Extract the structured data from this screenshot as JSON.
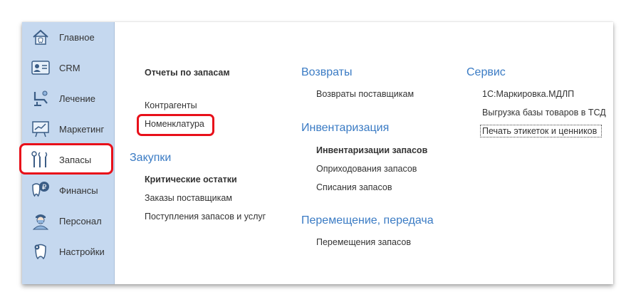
{
  "sidebar": {
    "items": [
      {
        "label": "Главное",
        "icon": "tooth-home-icon"
      },
      {
        "label": "CRM",
        "icon": "contact-card-icon"
      },
      {
        "label": "Лечение",
        "icon": "dental-chair-icon"
      },
      {
        "label": "Маркетинг",
        "icon": "presentation-board-icon"
      },
      {
        "label": "Запасы",
        "icon": "dental-tools-icon"
      },
      {
        "label": "Финансы",
        "icon": "tooth-coin-icon"
      },
      {
        "label": "Персонал",
        "icon": "doctor-icon"
      },
      {
        "label": "Настройки",
        "icon": "tooth-gear-icon"
      }
    ],
    "active_index": 4
  },
  "columns": {
    "col1": {
      "section_title": "Отчеты по запасам",
      "links": [
        "Контрагенты",
        "Номенклатура"
      ],
      "purchases_header": "Закупки",
      "purchases_bold": "Критические остатки",
      "purchases_links": [
        "Заказы поставщикам",
        "Поступления запасов и услуг"
      ]
    },
    "col2": {
      "returns_header": "Возвраты",
      "returns_links": [
        "Возвраты поставщикам"
      ],
      "inventory_header": "Инвентаризация",
      "inventory_bold": "Инвентаризации запасов",
      "inventory_links": [
        "Оприходования запасов",
        "Списания запасов"
      ],
      "transfer_header": "Перемещение, передача",
      "transfer_links": [
        "Перемещения запасов"
      ]
    },
    "col3": {
      "service_header": "Сервис",
      "service_links": [
        "1С:Маркировка.МДЛП",
        "Выгрузка базы товаров в ТСД",
        "Печать этикеток и ценников"
      ]
    }
  },
  "colors": {
    "sidebar_bg": "#c5d8ef",
    "header_blue": "#3a7bc4",
    "highlight_red": "#e8101a"
  }
}
